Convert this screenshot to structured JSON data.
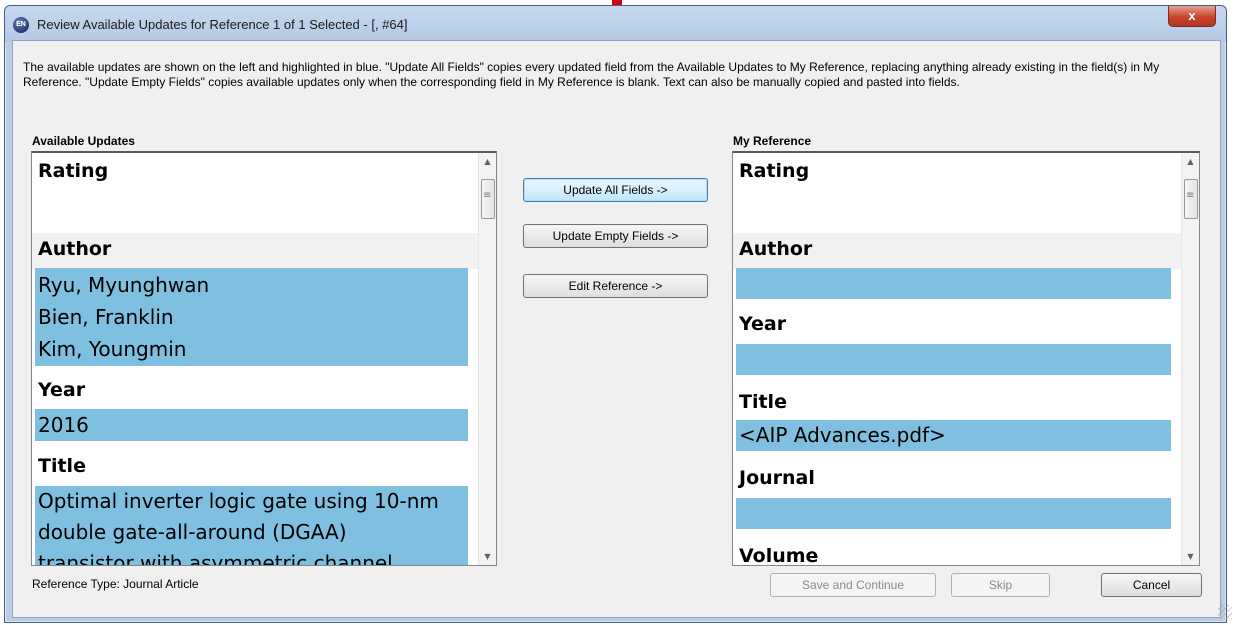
{
  "window": {
    "title": "Review Available Updates for Reference 1 of 1 Selected - [,  #64]",
    "app_icon": "EN",
    "close_label": "x"
  },
  "description": "The available updates are shown on the left and highlighted in blue. \"Update All Fields\" copies every updated field from the Available Updates to My Reference, replacing anything already existing in the field(s) in My Reference. \"Update Empty Fields\" copies available updates only when the corresponding field in My Reference is blank. Text can also be manually copied and pasted into fields.",
  "available_updates": {
    "heading": "Available Updates",
    "rating_label": "Rating",
    "author_label": "Author",
    "authors": [
      "Ryu, Myunghwan",
      "Bien, Franklin",
      "Kim, Youngmin"
    ],
    "year_label": "Year",
    "year_value": "2016",
    "title_label": "Title",
    "title_lines": [
      "Optimal inverter logic gate using 10-nm",
      "double gate-all-around (DGAA)",
      "transistor with asymmetric channel"
    ]
  },
  "my_reference": {
    "heading": "My Reference",
    "rating_label": "Rating",
    "author_label": "Author",
    "author_value": "",
    "year_label": "Year",
    "year_value": "",
    "title_label": "Title",
    "title_value": "<AIP Advances.pdf>",
    "journal_label": "Journal",
    "journal_value": "",
    "volume_label": "Volume"
  },
  "actions": {
    "update_all": "Update All Fields ->",
    "update_empty": "Update Empty Fields ->",
    "edit_reference": "Edit Reference ->"
  },
  "footer": {
    "reference_type": "Reference Type: Journal Article",
    "save_continue": "Save and Continue",
    "skip": "Skip",
    "cancel": "Cancel"
  },
  "icons": {
    "scroll_up": "▲",
    "scroll_down": "▼"
  },
  "colors": {
    "highlight": "#7fbfdf",
    "title_bar": "#b9cde6",
    "close": "#c7442c"
  }
}
